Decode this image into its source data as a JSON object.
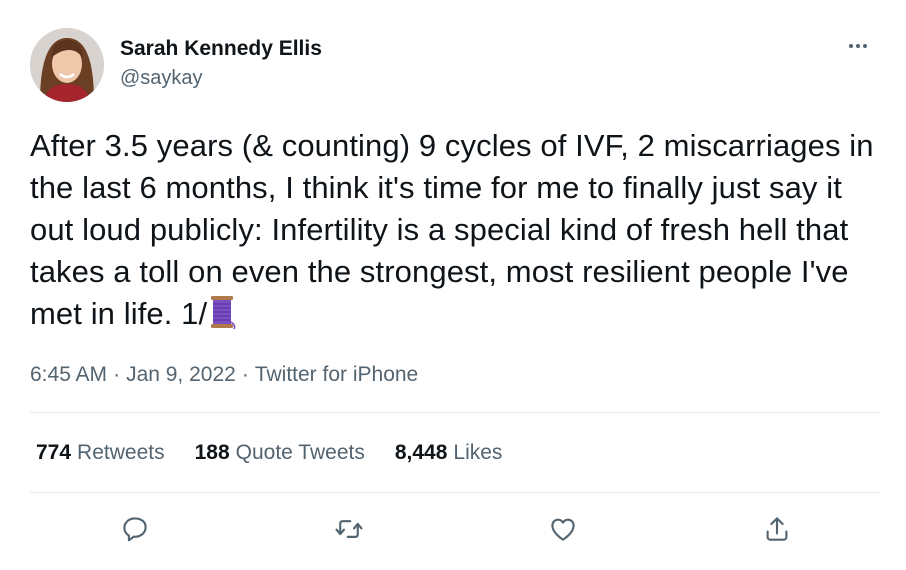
{
  "author": {
    "display_name": "Sarah Kennedy Ellis",
    "handle": "@saykay",
    "avatar_icon": "profile-photo"
  },
  "tweet": {
    "text": "After 3.5 years (& counting) 9 cycles of IVF, 2 miscarriages in the last 6 months, I think it's time for me to finally just say it out loud publicly: Infertility is a special kind of fresh hell that takes a toll on even the strongest, most resilient people I've met in life. 1/",
    "trailing_emoji": "thread-spool-emoji"
  },
  "meta": {
    "time": "6:45 AM",
    "separator": "·",
    "date": "Jan 9, 2022",
    "source": "Twitter for iPhone"
  },
  "stats": {
    "retweets_count": "774",
    "retweets_label": "Retweets",
    "quotes_count": "188",
    "quotes_label": "Quote Tweets",
    "likes_count": "8,448",
    "likes_label": "Likes"
  },
  "actions": [
    "reply-icon",
    "retweet-icon",
    "like-icon",
    "share-icon"
  ],
  "colors": {
    "text_primary": "#0f1419",
    "text_secondary": "#536471",
    "divider": "#e6ecf0",
    "spool": "#7b4fc4"
  }
}
